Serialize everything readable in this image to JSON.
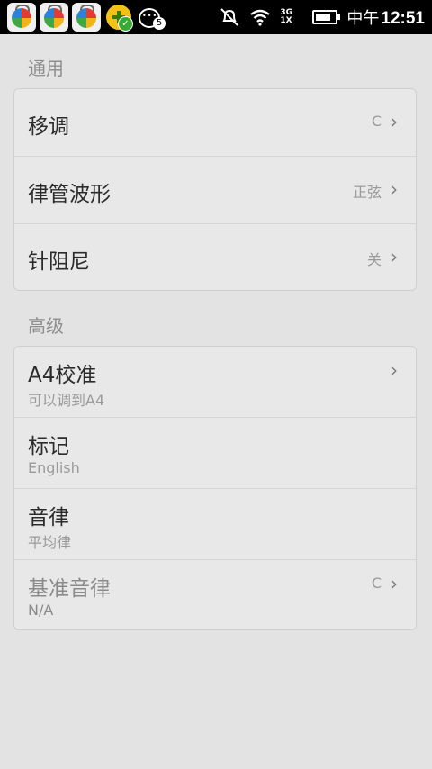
{
  "status_bar": {
    "ampm": "中午",
    "time": "12:51",
    "chat_badge": "5",
    "network": "3G 1X"
  },
  "general": {
    "header": "通用",
    "items": [
      {
        "title": "移调",
        "value": "C"
      },
      {
        "title": "律管波形",
        "value": "正弦"
      },
      {
        "title": "针阻尼",
        "value": "关"
      }
    ]
  },
  "advanced": {
    "header": "高级",
    "items": [
      {
        "title": "A4校准",
        "subtitle": "可以调到A4"
      },
      {
        "title": "标记",
        "subtitle": "English"
      },
      {
        "title": "音律",
        "subtitle": "平均律"
      },
      {
        "title": "基准音律",
        "subtitle": "N/A",
        "value": "C"
      }
    ]
  },
  "icons": {
    "chevron": "chevron-right-icon"
  }
}
